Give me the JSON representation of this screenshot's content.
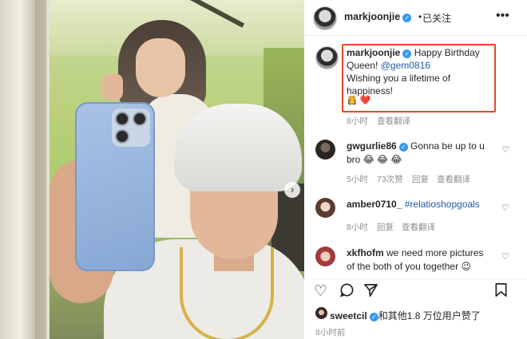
{
  "post": {
    "author": "markjoonjie",
    "separator": "•",
    "follow_status": "已关注",
    "more_icon": "more-horizontal-icon",
    "image_nav": "›"
  },
  "caption": {
    "username": "markjoonjie",
    "text_line1": "Happy Birthday",
    "text_line2": "Queen!",
    "mention": "@gem0816",
    "text_line3": "Wishing you a lifetime of",
    "text_line4": "happiness!",
    "emojis": "👸 ❤️",
    "time": "8小时",
    "translate": "查看翻译"
  },
  "comments": [
    {
      "username": "gwgurlie86",
      "verified": true,
      "text": "Gonna be up to u",
      "text2": "bro 😂 😂 😂",
      "time": "5小时",
      "likes": "73次赞",
      "reply": "回复",
      "translate": "查看翻译"
    },
    {
      "username": "amber0710_",
      "tag": "#relatioshopgoals",
      "time": "8小时",
      "reply": "回复",
      "translate": "查看翻译"
    },
    {
      "username": "xkfhofm",
      "text": "we need more pictures",
      "text2": "of the both of you together 😉"
    }
  ],
  "footer": {
    "liked_by_user": "sweetcil",
    "liked_by_rest": "和其他1.8 万位用户赞了",
    "post_time": "8小时前"
  }
}
